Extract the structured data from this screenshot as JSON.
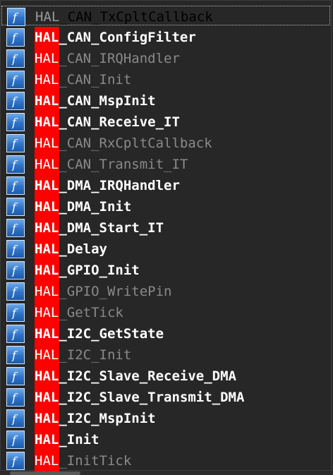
{
  "prefix": "HAL",
  "items": [
    {
      "suffix": "_CAN_TxCpltCallback",
      "style": "plain",
      "selected": true
    },
    {
      "suffix": "_CAN_ConfigFilter",
      "style": "bold"
    },
    {
      "suffix": "_CAN_IRQHandler",
      "style": "dim"
    },
    {
      "suffix": "_CAN_Init",
      "style": "dim"
    },
    {
      "suffix": "_CAN_MspInit",
      "style": "bold"
    },
    {
      "suffix": "_CAN_Receive_IT",
      "style": "bold"
    },
    {
      "suffix": "_CAN_RxCpltCallback",
      "style": "dim"
    },
    {
      "suffix": "_CAN_Transmit_IT",
      "style": "dim"
    },
    {
      "suffix": "_DMA_IRQHandler",
      "style": "bold"
    },
    {
      "suffix": "_DMA_Init",
      "style": "bold"
    },
    {
      "suffix": "_DMA_Start_IT",
      "style": "bold"
    },
    {
      "suffix": "_Delay",
      "style": "bold"
    },
    {
      "suffix": "_GPIO_Init",
      "style": "bold"
    },
    {
      "suffix": "_GPIO_WritePin",
      "style": "dim"
    },
    {
      "suffix": "_GetTick",
      "style": "dim"
    },
    {
      "suffix": "_I2C_GetState",
      "style": "bold"
    },
    {
      "suffix": "_I2C_Init",
      "style": "dim"
    },
    {
      "suffix": "_I2C_Slave_Receive_DMA",
      "style": "bold"
    },
    {
      "suffix": "_I2C_Slave_Transmit_DMA",
      "style": "bold"
    },
    {
      "suffix": "_I2C_MspInit",
      "style": "bold"
    },
    {
      "suffix": "_Init",
      "style": "bold"
    },
    {
      "suffix": "_InitTick",
      "style": "dim"
    }
  ],
  "icon": "function-icon",
  "colors": {
    "highlight": "#ff0000",
    "icon_blue": "#2f73c9"
  }
}
